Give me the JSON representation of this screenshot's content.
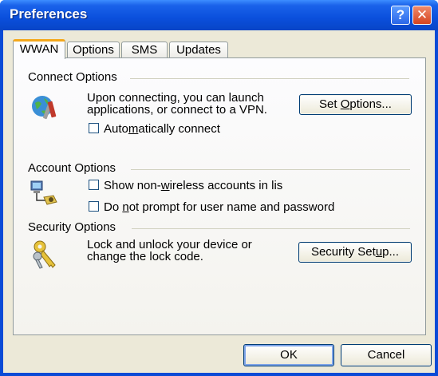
{
  "window": {
    "title": "Preferences",
    "help_icon": "?",
    "close_icon": "✕"
  },
  "tabs": [
    {
      "label": "WWAN",
      "active": true
    },
    {
      "label": "Options",
      "active": false
    },
    {
      "label": "SMS",
      "active": false
    },
    {
      "label": "Updates",
      "active": false
    }
  ],
  "connect": {
    "heading": "Connect Options",
    "icon": "globe-tools-icon",
    "description_line1": "Upon connecting, you can launch",
    "description_line2": "applications, or connect to a VPN.",
    "button_pre": "Set ",
    "button_key": "O",
    "button_post": "ptions...",
    "auto_pre": "Auto",
    "auto_key": "m",
    "auto_post": "atically connect",
    "auto_checked": false
  },
  "account": {
    "heading": "Account Options",
    "icon": "network-computer-icon",
    "nonwireless_pre": "Show non-",
    "nonwireless_key": "w",
    "nonwireless_post": "ireless accounts in lis",
    "nonwireless_checked": false,
    "noprompt_pre": "Do ",
    "noprompt_key": "n",
    "noprompt_post": "ot prompt for user name and password",
    "noprompt_checked": false
  },
  "security": {
    "heading": "Security Options",
    "icon": "keys-icon",
    "description_line1": "Lock and unlock your device or",
    "description_line2": "change the lock code.",
    "button_pre": "Security Set",
    "button_key": "u",
    "button_post": "p..."
  },
  "footer": {
    "ok_label": "OK",
    "cancel_label": "Cancel"
  }
}
